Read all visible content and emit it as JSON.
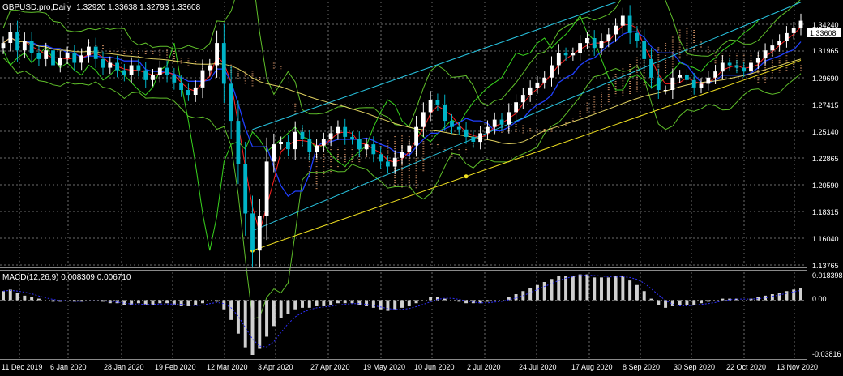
{
  "window": {
    "header": "GBPUSD.pro,Daily",
    "ohlc": "1.32920 1.33638 1.32793 1.33608"
  },
  "colors": {
    "background": "#000000",
    "bull_candle": "#ffffff",
    "bear_candle": "#00b4c8",
    "tenkan": "#ff2020",
    "kijun": "#2040ff",
    "chikou": "#39d41e",
    "kumo": "#e8a070",
    "bollinger": "#5fbf2a",
    "channel": "#28c4e0",
    "trendline": "#f0e020",
    "ma200": "#e0d060",
    "macd_hist": "#d0d0d0",
    "macd_signal": "#3030ff",
    "price_tag": "#ffffff"
  },
  "chart_data": [
    {
      "type": "line",
      "title": "GBPUSD.pro,Daily",
      "instrument": "GBPUSD.pro",
      "timeframe": "Daily",
      "last_ohlc": {
        "open": 1.3292,
        "high": 1.33638,
        "low": 1.32793,
        "close": 1.33608
      },
      "current_price": "1.33608",
      "y_ticks": [
        "1.34240",
        "1.31965",
        "1.29690",
        "1.27415",
        "1.25140",
        "1.22865",
        "1.20590",
        "1.18315",
        "1.16040",
        "1.13765"
      ],
      "ylim": [
        1.13765,
        1.3515
      ],
      "x_ticks": [
        "11 Dec 2019",
        "6 Jan 2020",
        "28 Jan 2020",
        "19 Feb 2020",
        "12 Mar 2020",
        "3 Apr 2020",
        "27 Apr 2020",
        "19 May 2020",
        "10 Jun 2020",
        "2 Jul 2020",
        "24 Jul 2020",
        "17 Aug 2020",
        "8 Sep 2020",
        "30 Sep 2020",
        "22 Oct 2020",
        "13 Nov 2020"
      ],
      "grid": true,
      "close_series": [
        1.318,
        1.327,
        1.312,
        1.32,
        1.31,
        1.305,
        1.312,
        1.3,
        1.306,
        1.31,
        1.302,
        1.308,
        1.315,
        1.305,
        1.298,
        1.302,
        1.296,
        1.292,
        1.3,
        1.296,
        1.288,
        1.292,
        1.298,
        1.292,
        1.286,
        1.28,
        1.276,
        1.282,
        1.296,
        1.3,
        1.318,
        1.285,
        1.255,
        1.22,
        1.18,
        1.15,
        1.178,
        1.222,
        1.236,
        1.238,
        1.232,
        1.246,
        1.24,
        1.23,
        1.235,
        1.24,
        1.245,
        1.25,
        1.242,
        1.24,
        1.232,
        1.236,
        1.228,
        1.222,
        1.218,
        1.225,
        1.23,
        1.235,
        1.25,
        1.262,
        1.272,
        1.268,
        1.255,
        1.25,
        1.248,
        1.242,
        1.238,
        1.245,
        1.25,
        1.256,
        1.252,
        1.262,
        1.27,
        1.276,
        1.282,
        1.286,
        1.29,
        1.3,
        1.31,
        1.308,
        1.31,
        1.318,
        1.322,
        1.314,
        1.32,
        1.325,
        1.332,
        1.34,
        1.326,
        1.32,
        1.305,
        1.29,
        1.28,
        1.28,
        1.29,
        1.292,
        1.288,
        1.282,
        1.285,
        1.29,
        1.295,
        1.302,
        1.3,
        1.298,
        1.295,
        1.302,
        1.306,
        1.312,
        1.316,
        1.32,
        1.326,
        1.33,
        1.336
      ],
      "annotations": [
        "Ichimoku Kinko Hyo",
        "Bollinger Bands",
        "Rising channel",
        "Ascending trendline from 12 Mar 2020 low"
      ]
    },
    {
      "type": "bar",
      "title": "MACD(12,26,9) 0.008309 0.006710",
      "name": "MACD(12,26,9)",
      "values_label": "0.008309 0.006710",
      "y_ticks": [
        "0.018398",
        "0.00",
        "-0.03816"
      ],
      "ylim": [
        -0.03816,
        0.018398
      ],
      "macd_last": 0.008309,
      "signal_last": 0.00671,
      "hist_series": [
        0.006,
        0.007,
        0.005,
        0.003,
        0.002,
        0.001,
        0.0,
        -0.001,
        -0.001,
        0.0,
        -0.001,
        -0.001,
        0.0,
        0.0,
        -0.001,
        -0.002,
        -0.002,
        -0.003,
        -0.003,
        -0.002,
        -0.003,
        -0.003,
        -0.002,
        -0.002,
        -0.003,
        -0.004,
        -0.004,
        -0.003,
        -0.002,
        0.0,
        -0.001,
        -0.006,
        -0.013,
        -0.022,
        -0.031,
        -0.036,
        -0.032,
        -0.024,
        -0.017,
        -0.012,
        -0.009,
        -0.006,
        -0.005,
        -0.005,
        -0.004,
        -0.004,
        -0.003,
        -0.002,
        -0.002,
        -0.002,
        -0.003,
        -0.004,
        -0.005,
        -0.006,
        -0.007,
        -0.006,
        -0.005,
        -0.004,
        -0.002,
        0.0,
        0.002,
        0.002,
        0.001,
        0.0,
        -0.001,
        -0.002,
        -0.002,
        -0.002,
        -0.001,
        0.0,
        0.0,
        0.002,
        0.004,
        0.006,
        0.008,
        0.01,
        0.012,
        0.014,
        0.016,
        0.016,
        0.016,
        0.017,
        0.017,
        0.015,
        0.015,
        0.015,
        0.016,
        0.016,
        0.013,
        0.01,
        0.006,
        0.001,
        -0.003,
        -0.005,
        -0.004,
        -0.003,
        -0.003,
        -0.003,
        -0.002,
        -0.001,
        0.0,
        0.001,
        0.001,
        0.001,
        0.0,
        0.001,
        0.002,
        0.003,
        0.004,
        0.005,
        0.006,
        0.007,
        0.008
      ]
    }
  ]
}
